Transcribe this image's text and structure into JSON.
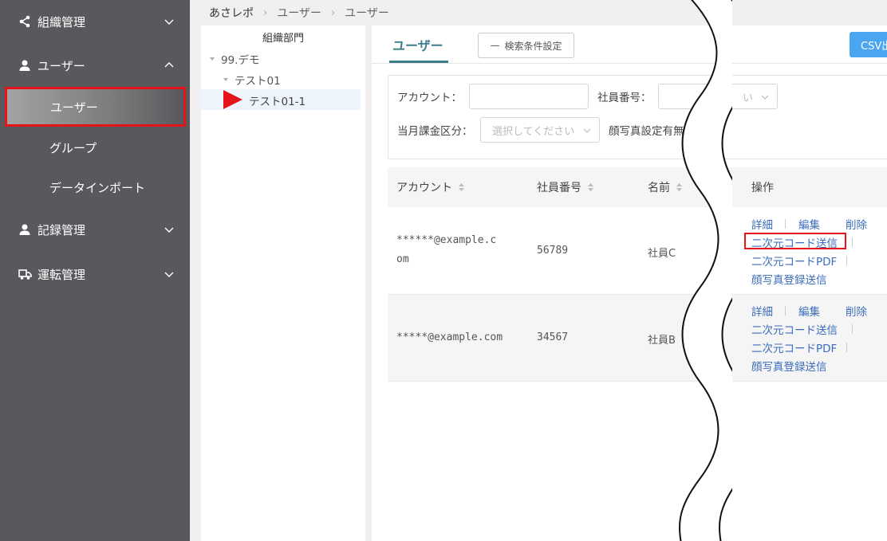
{
  "sidebar": {
    "items": [
      {
        "label": "組織管理",
        "icon": "share-icon"
      },
      {
        "label": "ユーザー",
        "icon": "user-icon"
      },
      {
        "label": "記録管理",
        "icon": "person-icon"
      },
      {
        "label": "運転管理",
        "icon": "truck-icon"
      }
    ],
    "subitems": [
      "ユーザー",
      "グループ",
      "データインポート"
    ]
  },
  "breadcrumb": [
    "あさレポ",
    "ユーザー",
    "ユーザー"
  ],
  "tree": {
    "title": "組織部門",
    "nodes": [
      "99.デモ",
      "テスト01",
      "テスト01-1"
    ]
  },
  "tabs": {
    "user": "ユーザー",
    "search_button": "検索条件設定",
    "csv_button": "CSV出"
  },
  "filters": {
    "account_label": "アカウント：",
    "employee_no_label": "社員番号：",
    "employee_no_placeholder": "い",
    "billing_label": "当月課金区分：",
    "billing_placeholder": "選択してください",
    "photo_label": "顔写真設定有無"
  },
  "table": {
    "headers": [
      "アカウント",
      "社員番号",
      "名前",
      "操作"
    ],
    "rows": [
      {
        "account_line1": "******@example.c",
        "account_line2": "om",
        "employee_no": "56789",
        "name": "社員C"
      },
      {
        "account_line1": "*****@example.com",
        "account_line2": "",
        "employee_no": "34567",
        "name": "社員B"
      }
    ],
    "ops": {
      "detail": "詳細",
      "edit": "編集",
      "delete": "削除",
      "send_qr": "二次元コード送信",
      "qr_pdf": "二次元コードPDF",
      "send_photo": "顔写真登録送信"
    }
  },
  "colors": {
    "sidebar_bg": "#58595c",
    "accent": "#3d7d8c",
    "link": "#3c6dbd",
    "highlight": "#e4141a",
    "csv_button": "#4aa6f0"
  }
}
